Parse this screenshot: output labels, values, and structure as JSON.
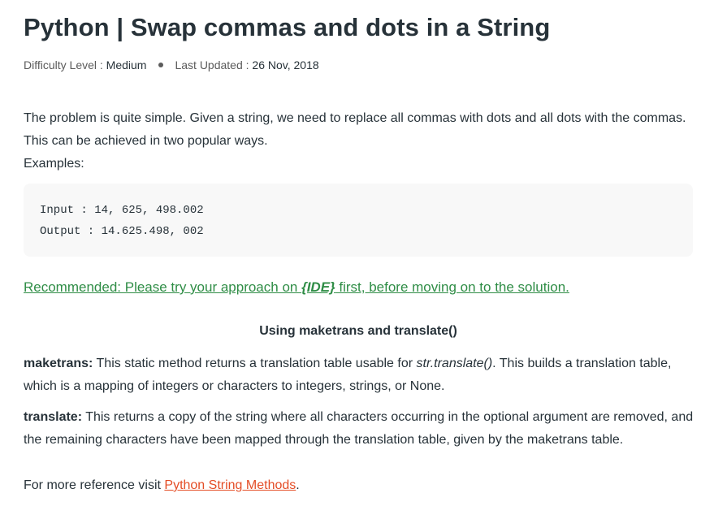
{
  "article": {
    "title": "Python | Swap commas and dots in a String",
    "difficulty_label": "Difficulty Level : ",
    "difficulty_value": "Medium",
    "updated_label": "Last Updated : ",
    "updated_value": "26 Nov, 2018"
  },
  "intro": {
    "text": "The problem is quite simple. Given a string, we need to replace all commas with dots and all dots with the commas. This can be achieved in two popular ways.",
    "examples_label": "Examples:"
  },
  "code": {
    "input_line": "Input : 14, 625, 498.002",
    "output_line": "Output : 14.625.498, 002"
  },
  "recommended": {
    "prefix": "Recommended: Please try your approach on ",
    "ide": "{IDE}",
    "suffix": " first, before moving on to the solution."
  },
  "section": {
    "heading": "Using maketrans and translate()"
  },
  "maketrans": {
    "term": "maketrans:",
    "text_before": " This static method returns a translation table usable for ",
    "italic": "str.translate()",
    "text_after": ". This builds a translation table, which is a mapping of integers or characters to integers, strings, or None."
  },
  "translate": {
    "term": "translate:",
    "text": " This returns a copy of the string where all characters occurring in the optional argument are removed, and the remaining characters have been mapped through the translation table, given by the maketrans table."
  },
  "reference": {
    "prefix": "For more reference visit ",
    "link": "Python String Methods",
    "suffix": "."
  },
  "colors": {
    "text": "#273239",
    "recommended_green": "#2f8d46",
    "link_orange": "#e44d26",
    "code_bg": "#f8f8f8"
  }
}
